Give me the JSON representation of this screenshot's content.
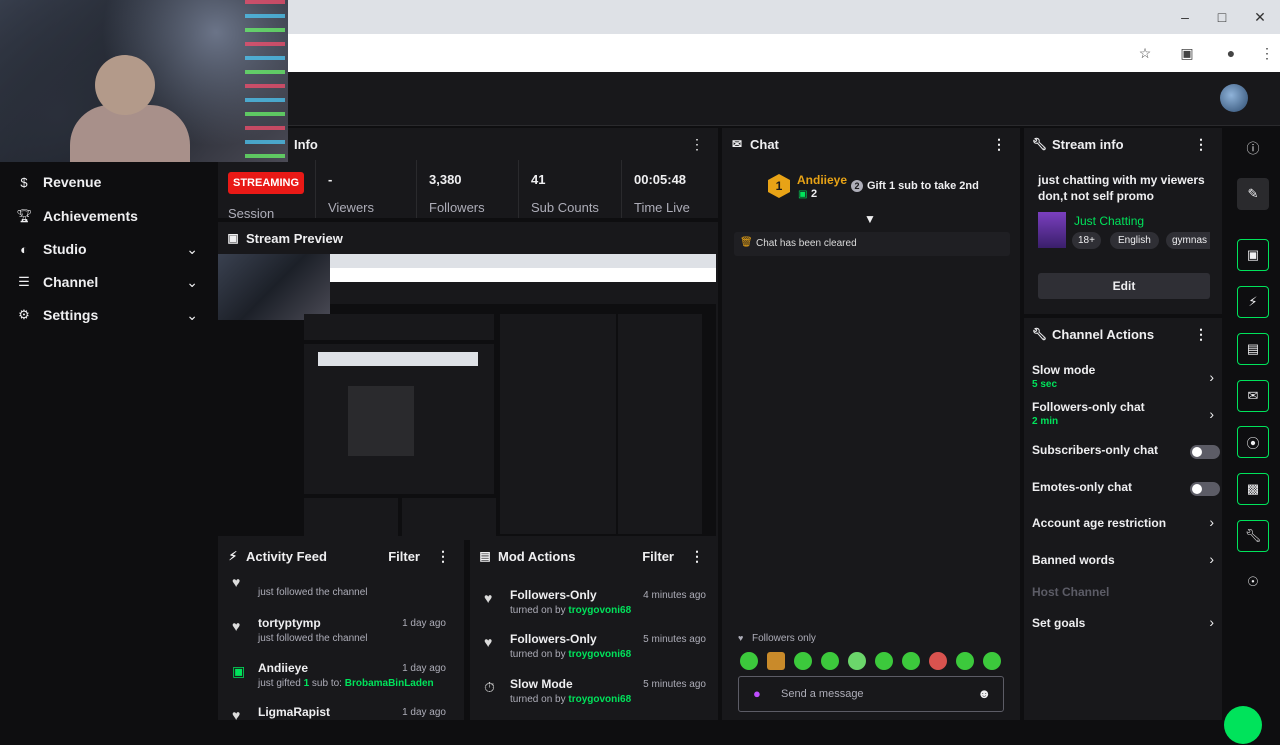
{
  "header": {
    "panel_title_info": "Info",
    "kebab": "⋮"
  },
  "stats": {
    "badge": "STREAMING",
    "session_label": "Session",
    "viewers_value": "-",
    "viewers_label": "Viewers",
    "followers_value": "3,380",
    "followers_label": "Followers",
    "subs_value": "41",
    "subs_label": "Sub Counts",
    "time_value": "00:05:48",
    "time_label": "Time Live"
  },
  "sidebar": {
    "items": [
      {
        "label": "Revenue",
        "icon": "dollar-icon"
      },
      {
        "label": "Achievements",
        "icon": "trophy-icon"
      },
      {
        "label": "Studio",
        "icon": "studio-icon"
      },
      {
        "label": "Channel",
        "icon": "channel-icon"
      },
      {
        "label": "Settings",
        "icon": "gear-icon"
      }
    ]
  },
  "preview": {
    "title": "Stream Preview"
  },
  "activity": {
    "title": "Activity Feed",
    "filter": "Filter",
    "items": [
      {
        "name": "",
        "sub": "just followed the channel",
        "time": ""
      },
      {
        "name": "tortyptymp",
        "sub": "just followed the channel",
        "time": "1 day ago"
      },
      {
        "name": "Andiieye",
        "sub_prefix": "just gifted ",
        "sub_count": "1",
        "sub_mid": " sub to: ",
        "sub_target": "BrobamaBinLaden",
        "time": "1 day ago"
      },
      {
        "name": "LigmaRapist",
        "sub": "",
        "time": "1 day ago"
      }
    ]
  },
  "mod": {
    "title": "Mod Actions",
    "filter": "Filter",
    "items": [
      {
        "name": "Followers-Only",
        "by_prefix": "turned on by ",
        "by": "troygovoni68",
        "time": "4 minutes ago"
      },
      {
        "name": "Followers-Only",
        "by_prefix": "turned on by ",
        "by": "troygovoni68",
        "time": "5 minutes ago"
      },
      {
        "name": "Slow Mode",
        "by_prefix": "turned on by ",
        "by": "troygovoni68",
        "time": "5 minutes ago"
      }
    ]
  },
  "chat": {
    "title": "Chat",
    "pinned_user": "Andiieye",
    "pinned_rank": "1",
    "pinned_count": "2",
    "pinned_gift_rank": "2",
    "pinned_gift_text": "Gift 1 sub to take 2nd",
    "cleared": "Chat has been cleared",
    "mode": "Followers only",
    "placeholder": "Send a message"
  },
  "stream_info": {
    "title": "Stream info",
    "stream_title": "just chatting with my viewers don,t not self promo",
    "category": "Just Chatting",
    "tags": [
      "18+",
      "English",
      "gymnas"
    ],
    "edit": "Edit"
  },
  "channel_actions": {
    "title": "Channel Actions",
    "slow_mode": "Slow mode",
    "slow_mode_value": "5 sec",
    "followers_only": "Followers-only chat",
    "followers_only_value": "2 min",
    "subscribers_only": "Subscribers-only chat",
    "emotes_only": "Emotes-only chat",
    "account_age": "Account age restriction",
    "banned_words": "Banned words",
    "host_channel": "Host Channel",
    "set_goals": "Set goals"
  },
  "colors": {
    "accent": "#00e35b",
    "live": "#e91916",
    "gold": "#e8a316"
  }
}
